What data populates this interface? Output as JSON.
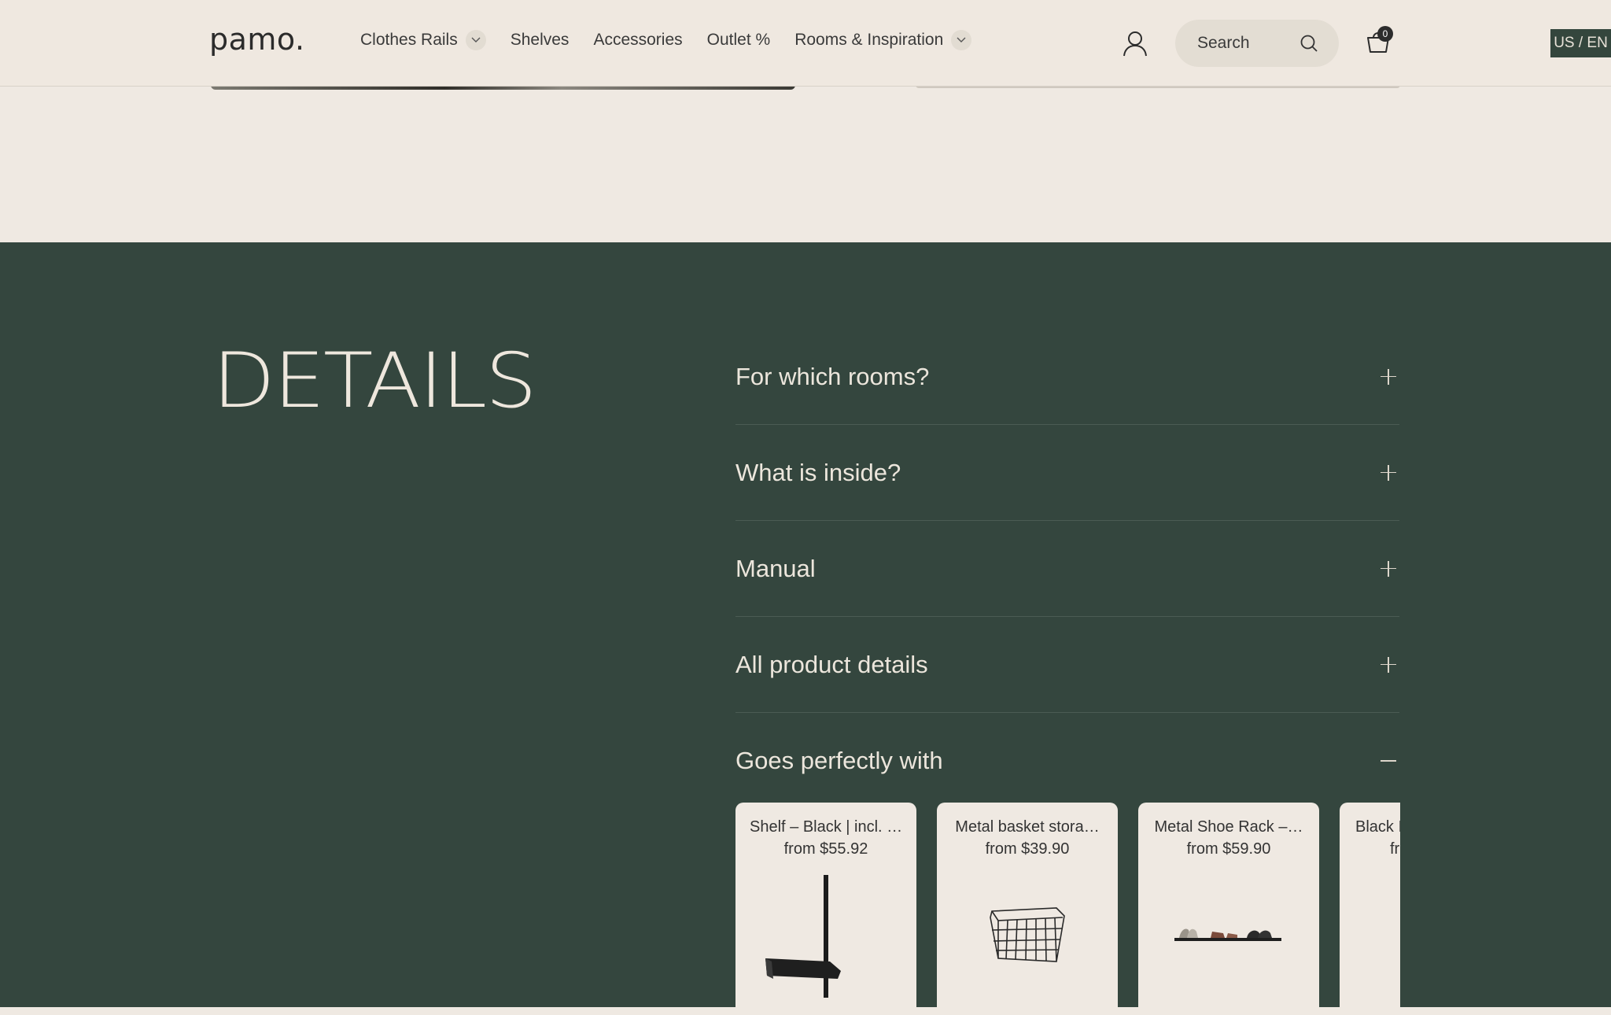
{
  "header": {
    "logo": "pamo.",
    "nav": [
      {
        "label": "Clothes Rails",
        "has_dropdown": true
      },
      {
        "label": "Shelves",
        "has_dropdown": false
      },
      {
        "label": "Accessories",
        "has_dropdown": false
      },
      {
        "label": "Outlet %",
        "has_dropdown": false
      },
      {
        "label": "Rooms & Inspiration",
        "has_dropdown": true
      }
    ],
    "account_icon": "user-icon",
    "search_placeholder": "Search",
    "cart_count": "0",
    "locale": "US / EN"
  },
  "details": {
    "title": "Details",
    "accordion": [
      {
        "label": "For which rooms?",
        "open": false
      },
      {
        "label": "What is inside?",
        "open": false
      },
      {
        "label": "Manual",
        "open": false
      },
      {
        "label": "All product details",
        "open": false
      },
      {
        "label": "Goes perfectly with",
        "open": true
      }
    ],
    "products": [
      {
        "title": "Shelf – Black | incl. …",
        "price": "from $55.92",
        "image": "black-shelf-with-bracket"
      },
      {
        "title": "Metal basket stora…",
        "price": "from $39.90",
        "image": "wire-basket"
      },
      {
        "title": "Metal Shoe Rack –…",
        "price": "from $59.90",
        "image": "shoe-rack-with-shoes"
      },
      {
        "title": "Black I",
        "price": "fr",
        "image": "partial-product"
      }
    ]
  },
  "colors": {
    "page_bg": "#efe9e2",
    "section_bg": "#34463e",
    "text_light": "#ece6dc",
    "text_dark": "#333333"
  }
}
